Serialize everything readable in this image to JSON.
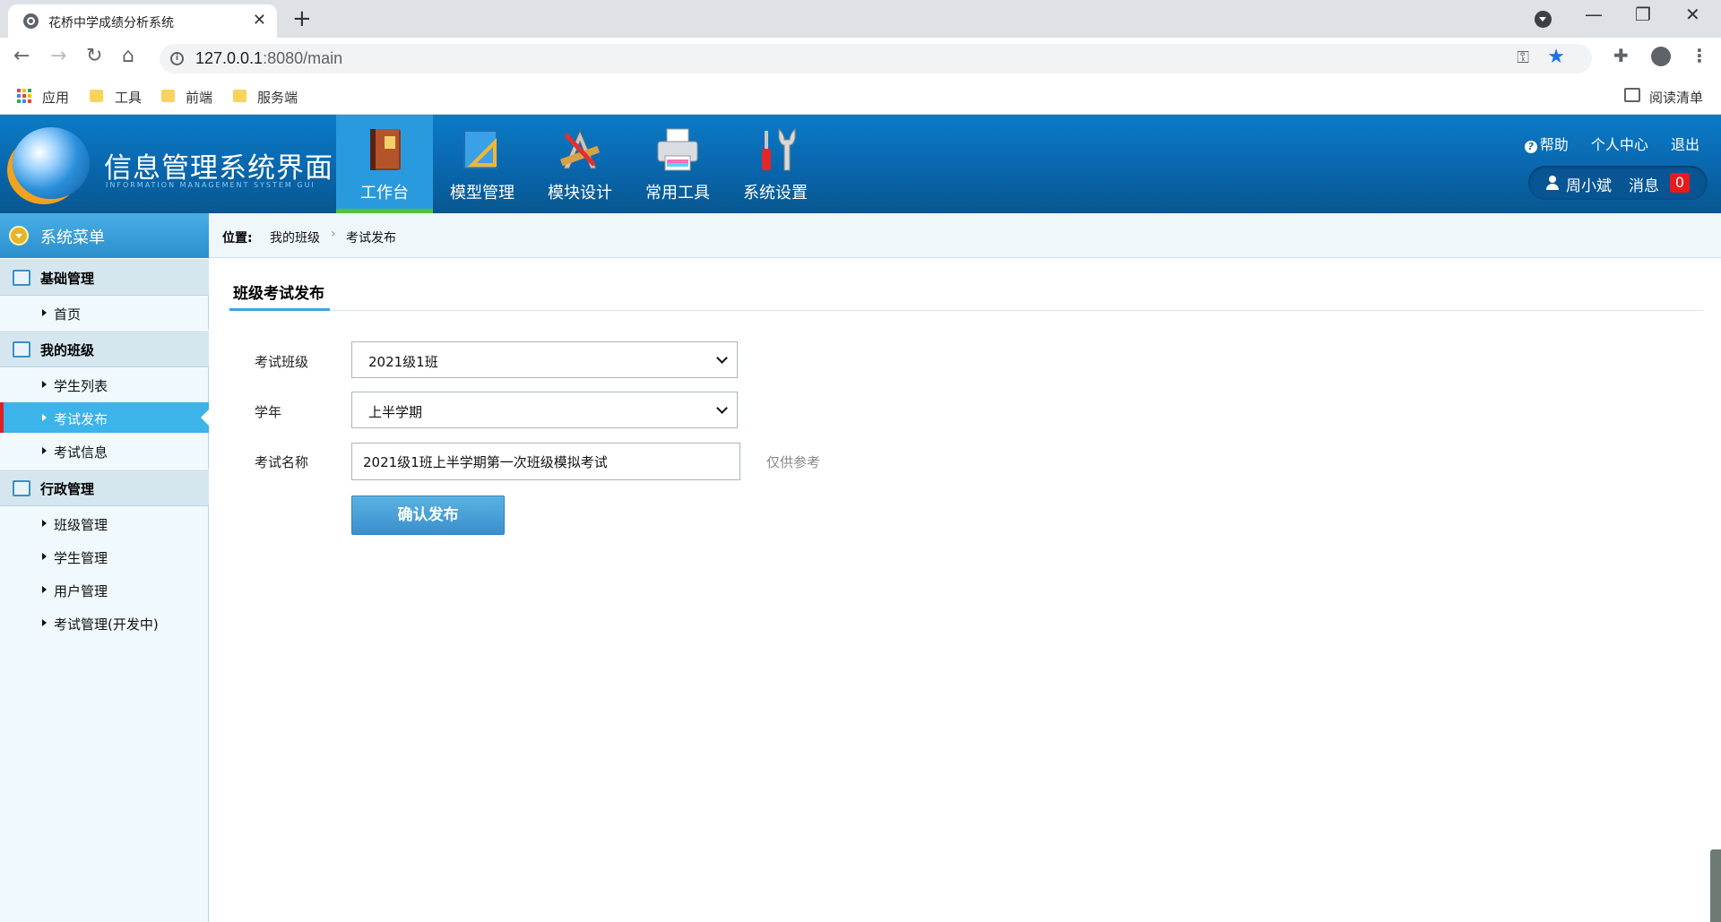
{
  "browser": {
    "tab_title": "花桥中学成绩分析系统",
    "tab_close": "✕",
    "new_tab": "+",
    "url_host": "127.0.0.1",
    "url_rest": ":8080/main",
    "window_controls": [
      "—",
      "❐",
      "✕"
    ],
    "bookmarks": [
      "应用",
      "工具",
      "前端",
      "服务端"
    ],
    "reading_list": "阅读清单"
  },
  "header": {
    "logo_title": "信息管理系统界面",
    "logo_subtitle": "INFORMATION MANAGEMENT SYSTEM GUI",
    "nav": [
      {
        "label": "工作台",
        "icon": "book-icon",
        "active": true
      },
      {
        "label": "模型管理",
        "icon": "ruler-icon",
        "active": false
      },
      {
        "label": "模块设计",
        "icon": "compass-icon",
        "active": false
      },
      {
        "label": "常用工具",
        "icon": "printer-icon",
        "active": false
      },
      {
        "label": "系统设置",
        "icon": "tools-icon",
        "active": false
      }
    ],
    "help": "帮助",
    "personal_center": "个人中心",
    "logout": "退出",
    "user_name": "周小斌",
    "messages_label": "消息",
    "messages_count": "0"
  },
  "sidebar": {
    "title": "系统菜单",
    "groups": [
      {
        "label": "基础管理",
        "icon": "list-icon",
        "items": [
          "首页"
        ]
      },
      {
        "label": "我的班级",
        "icon": "chat-icon",
        "items": [
          "学生列表",
          "考试发布",
          "考试信息"
        ]
      },
      {
        "label": "行政管理",
        "icon": "edit-icon",
        "items": [
          "班级管理",
          "学生管理",
          "用户管理",
          "考试管理(开发中)"
        ]
      }
    ],
    "active_item": "考试发布"
  },
  "breadcrumb": {
    "prefix": "位置:",
    "level1": "我的班级",
    "sep": "›",
    "level2": "考试发布"
  },
  "form": {
    "section_title": "班级考试发布",
    "class_label": "考试班级",
    "class_value": "2021级1班",
    "year_label": "学年",
    "year_value": "上半学期",
    "name_label": "考试名称",
    "name_value": "2021级1班上半学期第一次班级模拟考试",
    "hint": "仅供参考",
    "submit": "确认发布"
  },
  "colors": {
    "header_blue": "#0968b0",
    "active_nav": "#2a9adf",
    "active_green": "#55c13b",
    "sidebar_active": "#3cb3e9",
    "badge_red": "#e81a1a"
  }
}
